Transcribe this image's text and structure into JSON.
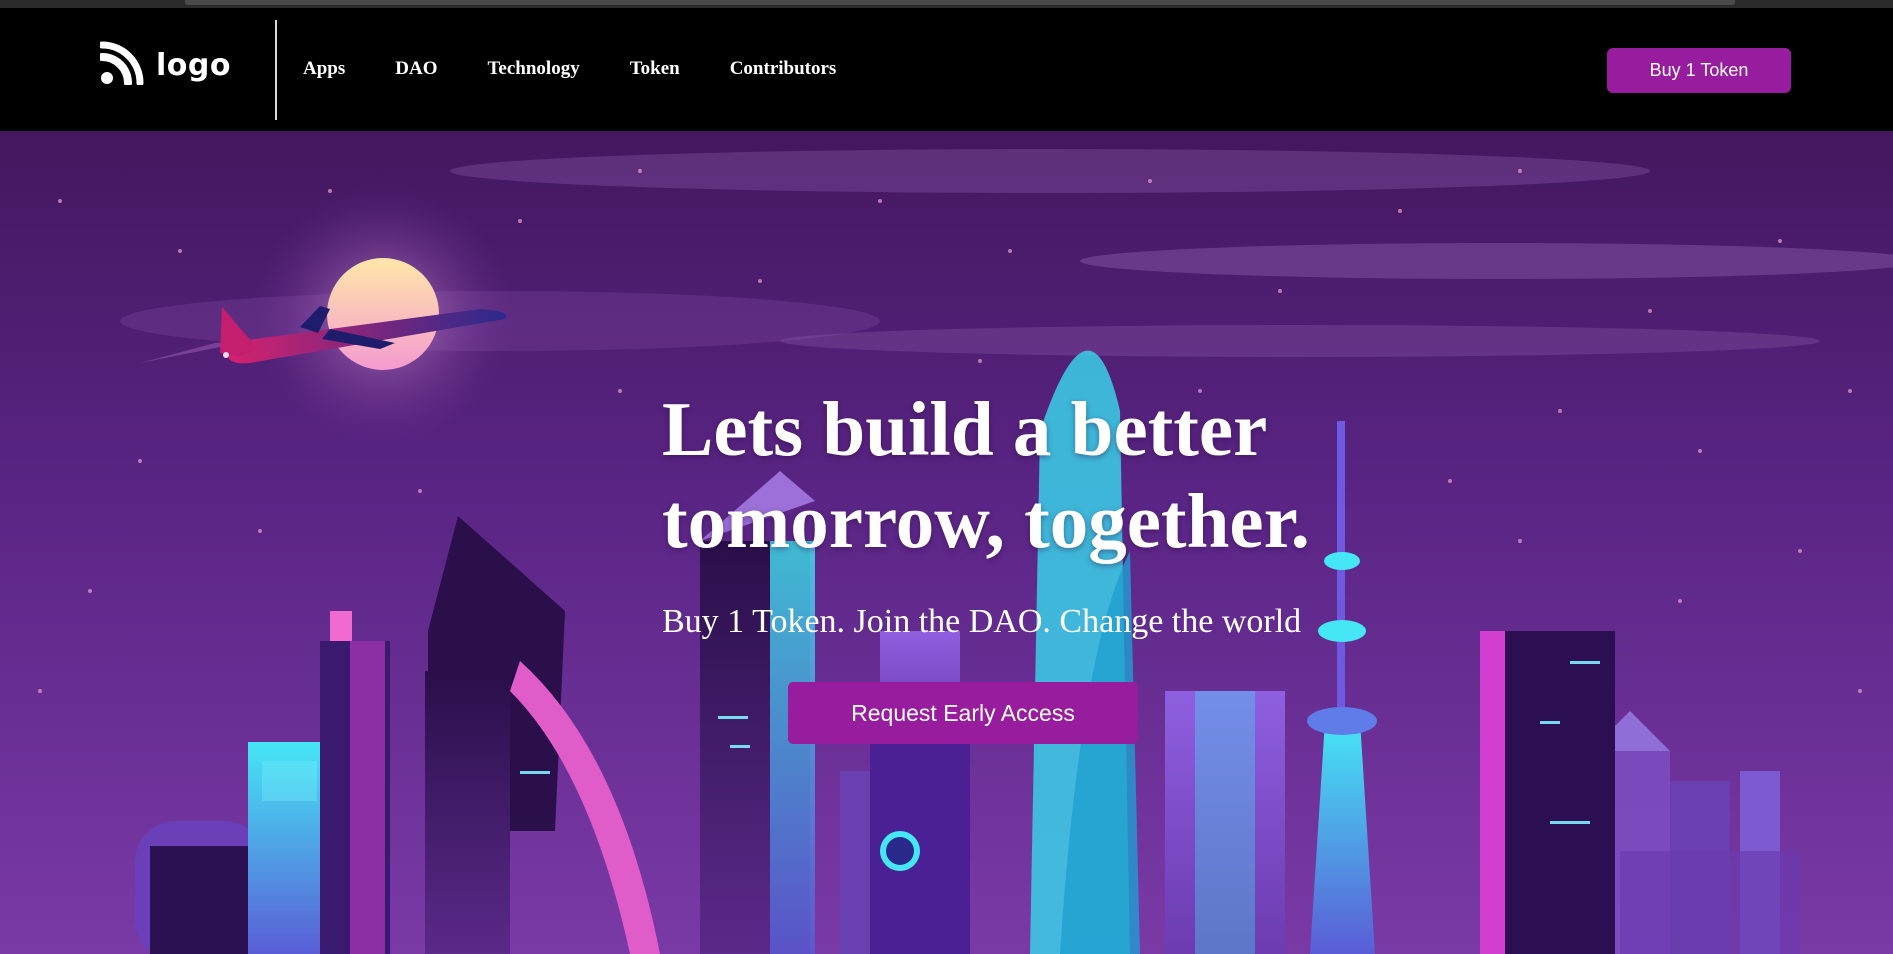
{
  "header": {
    "logo_text": "logo",
    "logo_icon": "rss-feed-icon",
    "nav_items": [
      {
        "label": "Apps"
      },
      {
        "label": "DAO"
      },
      {
        "label": "Technology"
      },
      {
        "label": "Token"
      },
      {
        "label": "Contributors"
      }
    ],
    "buy_button_label": "Buy 1 Token"
  },
  "hero": {
    "title_line1": "Lets build a better",
    "title_line2": "tomorrow, together.",
    "subtitle": "Buy 1 Token. Join the DAO. Change the world",
    "cta_label": "Request Early Access"
  },
  "colors": {
    "accent": "#981d9e",
    "navbar_bg": "#000000",
    "sky_top": "#4a1a6b",
    "sky_bottom": "#6b2f95",
    "neon_cyan": "#3fe0f0",
    "neon_pink": "#e040c8"
  }
}
